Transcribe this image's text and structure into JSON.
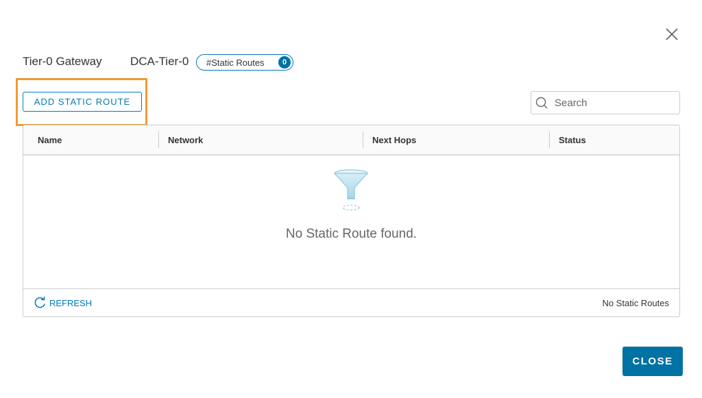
{
  "header": {
    "gateway_type": "Tier-0 Gateway",
    "gateway_name": "DCA-Tier-0",
    "routes_pill_label": "#Static Routes",
    "routes_pill_count": "0"
  },
  "toolbar": {
    "add_label": "ADD STATIC ROUTE",
    "search_placeholder": "Search"
  },
  "grid": {
    "columns": [
      "Name",
      "Network",
      "Next Hops",
      "Status"
    ],
    "rows": [],
    "empty_message": "No Static Route found.",
    "refresh_label": "REFRESH",
    "footer_count": "No Static Routes"
  },
  "actions": {
    "close_label": "CLOSE"
  },
  "colors": {
    "accent": "#0079b8",
    "primary_button": "#0072a3",
    "highlight": "#f09a33"
  },
  "icons": [
    "close-icon",
    "search-icon",
    "filter-icon",
    "refresh-icon"
  ]
}
